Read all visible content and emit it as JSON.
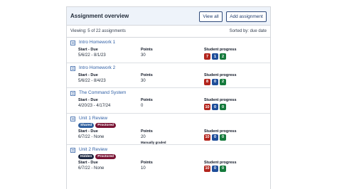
{
  "header": {
    "title": "Assignment overview",
    "view_all_label": "View all",
    "add_label": "Add assignment"
  },
  "subbar": {
    "viewing_text": "Viewing: 5 of 22 assignments",
    "sort_text": "Sorted by: due date"
  },
  "columns": {
    "start_due": "Start - Due",
    "points": "Points",
    "progress": "Student progress"
  },
  "colors": {
    "progress_red": "#b3261e",
    "progress_blue": "#1f4e9a",
    "progress_green": "#157a3c",
    "shared_tag": "#2f5f9e",
    "proctored_tag": "#7a1535",
    "hidden_tag": "#1f2a44"
  },
  "assignments": [
    {
      "icon": "assignment-icon",
      "title": "Intro Homework 1",
      "dates": "5/6/22 - 8/1/23",
      "points": "30",
      "progress": [
        "7",
        "1",
        "2"
      ]
    },
    {
      "icon": "assignment-icon",
      "title": "Intro Homework 2",
      "dates": "5/6/22 - 8/4/23",
      "points": "30",
      "progress": [
        "8",
        "0",
        "2"
      ]
    },
    {
      "icon": "assignment-icon",
      "title": "The Command System",
      "dates": "4/20/23 - 4/17/24",
      "points": "0",
      "progress": [
        "10",
        "0",
        "0"
      ]
    },
    {
      "icon": "assignment-icon",
      "title": "Unit 1 Review",
      "tags": [
        "Shared",
        "Proctored"
      ],
      "dates": "6/7/22 - None",
      "points": "20",
      "points_note": "Manually graded",
      "progress": [
        "10",
        "0",
        "0"
      ]
    },
    {
      "icon": "assignment-icon",
      "title": "Unit 2 Review",
      "tags": [
        "Hidden",
        "Proctored"
      ],
      "dates": "6/7/22 - None",
      "points": "10",
      "progress": [
        "10",
        "0",
        "0"
      ]
    }
  ]
}
